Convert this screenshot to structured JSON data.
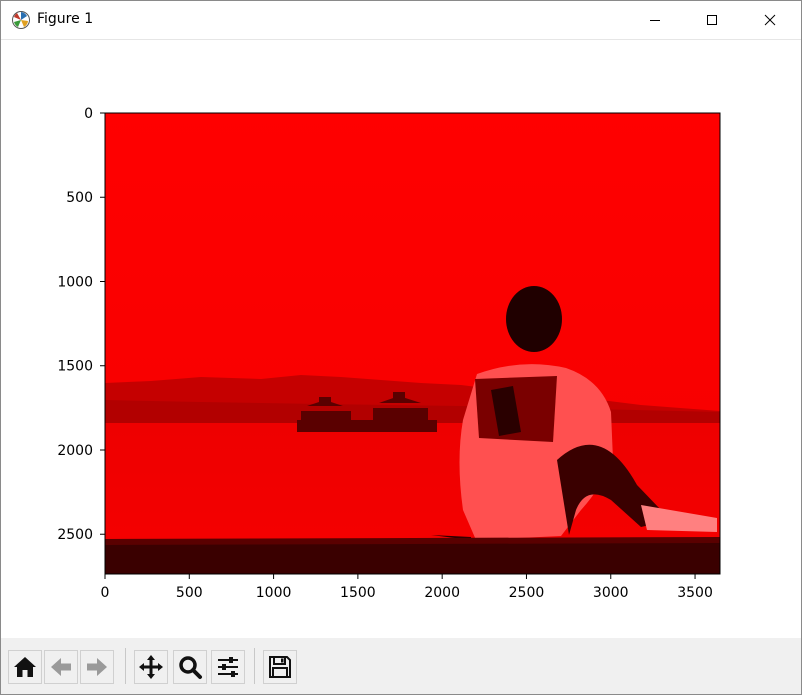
{
  "window": {
    "title": "Figure 1"
  },
  "icons": {
    "app": "matplotlib-icon",
    "minimize": "minimize-icon",
    "maximize": "maximize-icon",
    "close": "close-icon"
  },
  "toolbar": {
    "buttons": [
      {
        "name": "home-button",
        "icon": "home-icon"
      },
      {
        "name": "back-button",
        "icon": "arrow-left-icon"
      },
      {
        "name": "forward-button",
        "icon": "arrow-right-icon"
      },
      {
        "name": "pan-button",
        "icon": "move-icon"
      },
      {
        "name": "zoom-button",
        "icon": "magnifier-icon"
      },
      {
        "name": "configure-subplots-button",
        "icon": "sliders-icon"
      },
      {
        "name": "save-button",
        "icon": "floppy-disk-icon"
      }
    ]
  },
  "colors": {
    "image_red": "#ff0000",
    "toolbar_bg": "#f0f0f0"
  },
  "chart_data": {
    "type": "image",
    "x_ticks": [
      0,
      500,
      1000,
      1500,
      2000,
      2500,
      3000,
      3500
    ],
    "y_ticks": [
      0,
      500,
      1000,
      1500,
      2000,
      2500
    ],
    "xlim": [
      0,
      3648
    ],
    "ylim": [
      2736,
      0
    ],
    "title": "",
    "xlabel": "",
    "ylabel": ""
  }
}
